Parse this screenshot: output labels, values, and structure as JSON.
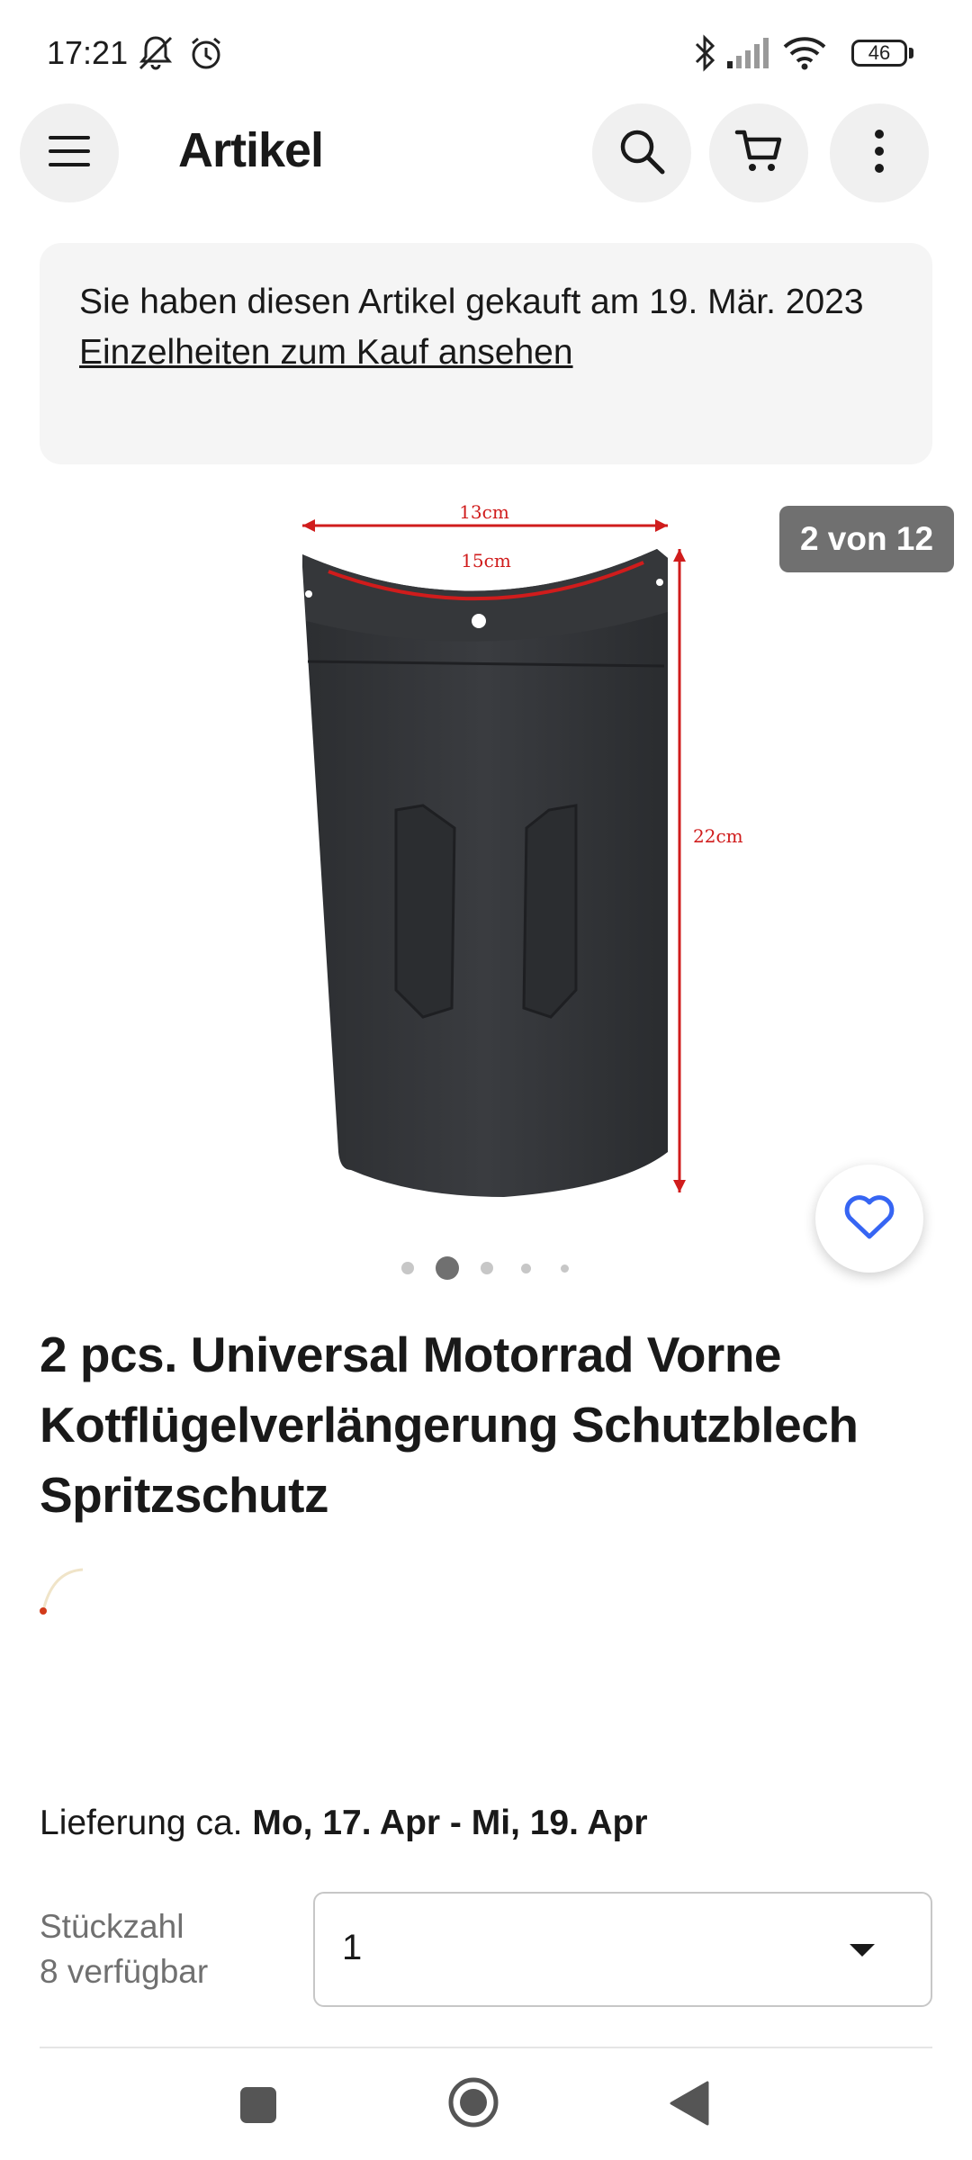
{
  "status_bar": {
    "time": "17:21",
    "icons": [
      "mute-notification-icon",
      "alarm-icon",
      "bluetooth-icon",
      "signal-icon",
      "wifi-icon"
    ],
    "battery": "46"
  },
  "header": {
    "title": "Artikel",
    "icons": [
      "menu-icon",
      "search-icon",
      "cart-icon",
      "more-vertical-icon"
    ]
  },
  "purchase_banner": {
    "text": "Sie haben diesen Artikel gekauft am 19. Mär. 2023",
    "link": "Einzelheiten zum Kauf ansehen"
  },
  "gallery": {
    "counter": "2 von 12",
    "image_labels": {
      "top_width": "13cm",
      "arc_width": "15cm",
      "height": "22cm"
    },
    "dots": 5,
    "active_dot": 2,
    "favorite_icon": "heart-icon"
  },
  "product": {
    "title": "2 pcs. Universal Motorrad Vorne Kotflügelverlängerung Schutzblech Spritzschutz"
  },
  "delivery": {
    "prefix": "Lieferung ca.",
    "dates": "Mo, 17. Apr - Mi, 19. Apr"
  },
  "quantity": {
    "label": "Stückzahl",
    "available": "8 verfügbar",
    "value": "1"
  },
  "nav_bar": {
    "icons": [
      "recents-icon",
      "home-icon",
      "back-icon"
    ]
  },
  "colors": {
    "accent": "#3665f3",
    "text": "#191919",
    "muted": "#707070",
    "measure_red": "#d01c1c"
  }
}
